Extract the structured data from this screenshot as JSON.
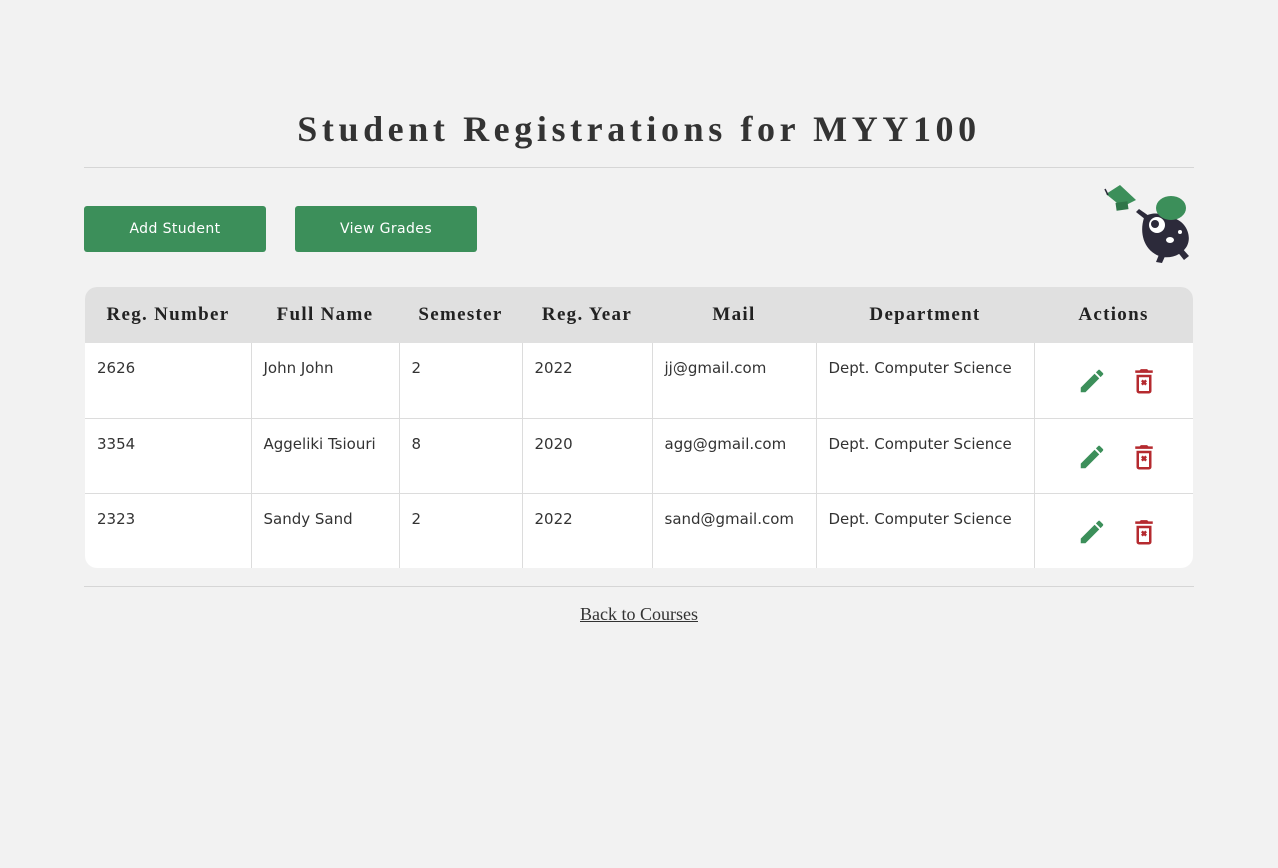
{
  "page": {
    "title": "Student Registrations for MYY100"
  },
  "toolbar": {
    "add_label": "Add Student",
    "grades_label": "View Grades"
  },
  "mascot": {
    "icon": "graduation-mascot-icon"
  },
  "table": {
    "headers": [
      "Reg. Number",
      "Full Name",
      "Semester",
      "Reg. Year",
      "Mail",
      "Department",
      "Actions"
    ],
    "rows": [
      {
        "reg_number": "2626",
        "full_name": "John John",
        "semester": "2",
        "reg_year": "2022",
        "mail": "jj@gmail.com",
        "department": "Dept. Computer Science"
      },
      {
        "reg_number": "3354",
        "full_name": "Aggeliki Tsiouri",
        "semester": "8",
        "reg_year": "2020",
        "mail": "agg@gmail.com",
        "department": "Dept. Computer Science"
      },
      {
        "reg_number": "2323",
        "full_name": "Sandy Sand",
        "semester": "2",
        "reg_year": "2022",
        "mail": "sand@gmail.com",
        "department": "Dept. Computer Science"
      }
    ],
    "edit_icon": "pencil-icon",
    "delete_icon": "trash-icon"
  },
  "footer": {
    "back_label": "Back to Courses"
  },
  "colors": {
    "accent": "#3c8f5a",
    "danger": "#b52a2f",
    "background": "#f2f2f2",
    "header_bg": "#e0e0e0"
  }
}
